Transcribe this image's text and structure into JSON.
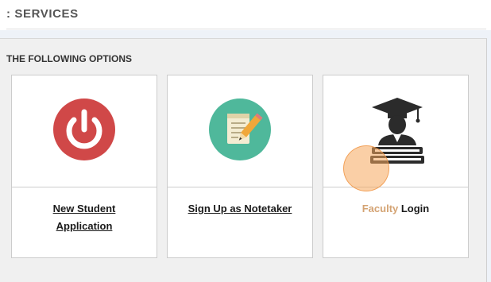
{
  "header": {
    "title": ": SERVICES"
  },
  "options": {
    "heading": "THE FOLLOWING OPTIONS",
    "cards": [
      {
        "icon": "power-icon",
        "label_line1": "New Student",
        "label_line2": "Application"
      },
      {
        "icon": "notepad-pencil-icon",
        "label": "Sign Up as Notetaker"
      },
      {
        "icon": "graduate-books-icon",
        "label_highlight": "Faculty",
        "label_rest": " Login"
      }
    ]
  },
  "colors": {
    "power_circle": "#d04848",
    "notepad_circle": "#4fb89b",
    "graduate_icon": "#2b2b2b",
    "click_marker": "#f5a85c"
  }
}
